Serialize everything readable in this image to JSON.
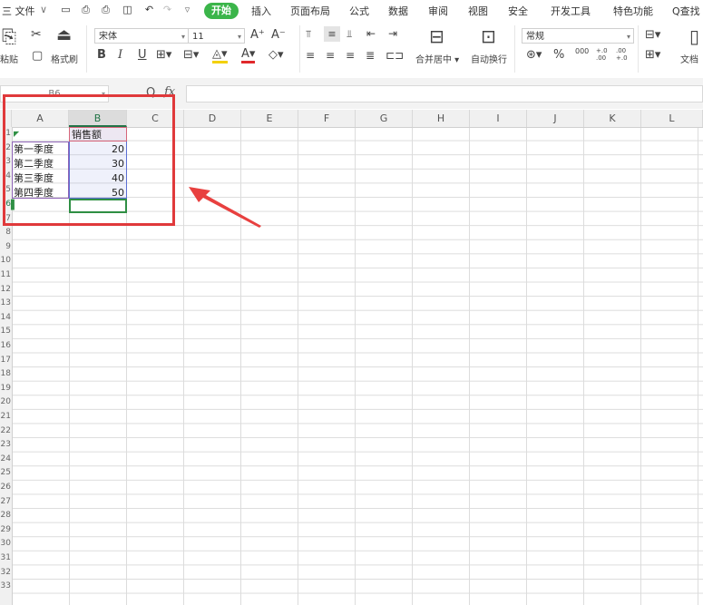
{
  "menu": {
    "items": [
      "三 文件",
      "开始",
      "插入",
      "页面布局",
      "公式",
      "数据",
      "审阅",
      "视图",
      "安全",
      "开发工具",
      "特色功能",
      "Q查找"
    ]
  },
  "ribbon": {
    "paste_label": "粘贴",
    "format_painter_label": "格式刷",
    "font_name": "宋体",
    "font_size": "11",
    "merge_label": "合并居中",
    "wrap_label": "自动换行",
    "number_format": "常规",
    "doc_label": "文档",
    "bold": "B",
    "italic": "I",
    "underline": "U",
    "percent": "%",
    "grow_font": "A⁺",
    "shrink_font": "A⁻",
    "font_color_letter": "A",
    "thousands": "000",
    "inc_decimal": "+.0 .00",
    "dec_decimal": ".00 +.0"
  },
  "formula_bar": {
    "name_box": "B6",
    "fx_label": "fx",
    "zoom_icon": "Q"
  },
  "columns": [
    "A",
    "B",
    "C",
    "D",
    "E",
    "F",
    "G",
    "H",
    "I",
    "J",
    "K",
    "L"
  ],
  "rows": [
    "1",
    "2",
    "3",
    "4",
    "5",
    "6",
    "7",
    "8",
    "9",
    "10",
    "11",
    "12",
    "13",
    "14",
    "15",
    "16",
    "17",
    "18",
    "19",
    "20",
    "21",
    "22",
    "23",
    "24",
    "25",
    "26",
    "27",
    "28",
    "29",
    "30",
    "31",
    "32",
    "33"
  ],
  "sheet": {
    "header_b": "销售额",
    "quarters": [
      "第一季度",
      "第二季度",
      "第三季度",
      "第四季度"
    ],
    "sales": [
      "20",
      "30",
      "40",
      "50"
    ]
  }
}
